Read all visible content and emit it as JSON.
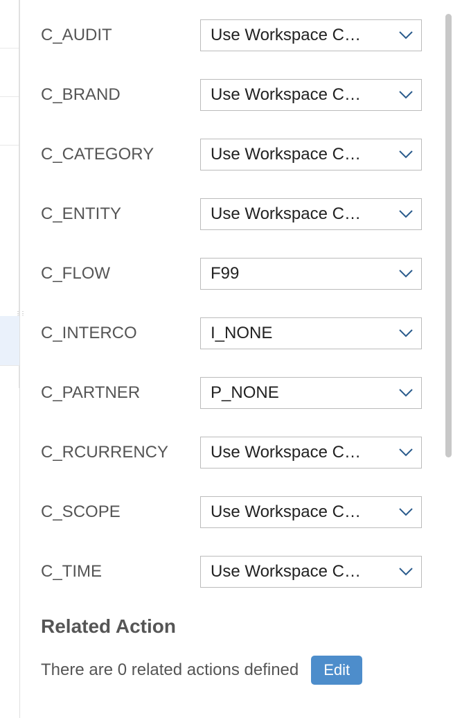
{
  "fields": [
    {
      "label": "C_AUDIT",
      "value": "Use Workspace C…"
    },
    {
      "label": "C_BRAND",
      "value": "Use Workspace C…"
    },
    {
      "label": "C_CATEGORY",
      "value": "Use Workspace C…"
    },
    {
      "label": "C_ENTITY",
      "value": "Use Workspace C…"
    },
    {
      "label": "C_FLOW",
      "value": "F99"
    },
    {
      "label": "C_INTERCO",
      "value": "I_NONE"
    },
    {
      "label": "C_PARTNER",
      "value": "P_NONE"
    },
    {
      "label": "C_RCURRENCY",
      "value": "Use Workspace C…"
    },
    {
      "label": "C_SCOPE",
      "value": "Use Workspace C…"
    },
    {
      "label": "C_TIME",
      "value": "Use Workspace C…"
    }
  ],
  "section_title": "Related Action",
  "related_text": "There are 0 related actions defined",
  "edit_label": "Edit"
}
